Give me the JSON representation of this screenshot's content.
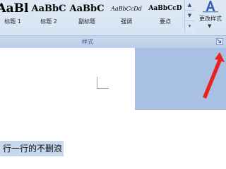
{
  "ribbon": {
    "styles_gallery": [
      {
        "preview": "AaBl",
        "caption": "标题 1"
      },
      {
        "preview": "AaBbC",
        "caption": "标题 2"
      },
      {
        "preview": "AaBbC",
        "caption": "副标题"
      },
      {
        "preview": "AaBbCcDd",
        "caption": "强调"
      },
      {
        "preview": "AaBbCcD",
        "caption": "要点"
      }
    ],
    "change_styles_label": "更改样式",
    "group_label": "样式"
  },
  "document": {
    "selected_text": "行一行的不删浪"
  },
  "colors": {
    "ribbon_bg": "#dfe9f5",
    "selection_bg": "#c6d7ee",
    "side_pane": "#a8c0e4",
    "annotation_arrow": "#e8231e"
  }
}
